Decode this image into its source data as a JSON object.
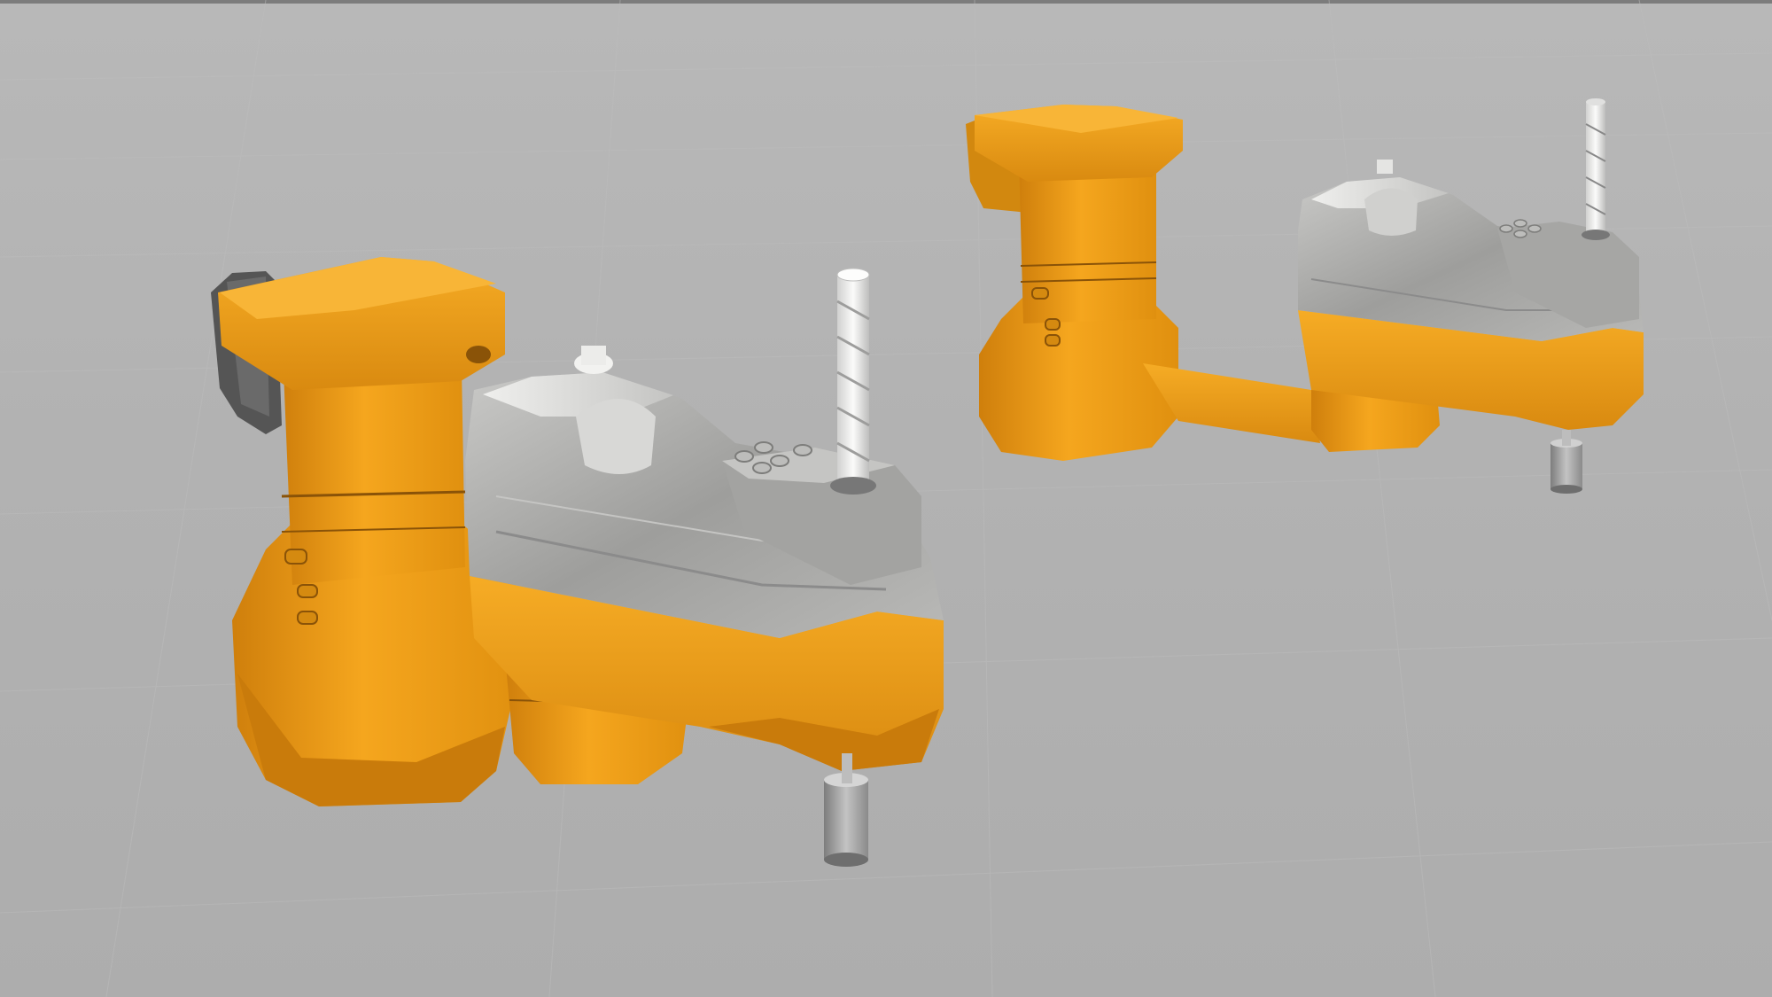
{
  "scene": {
    "background_color": "#b4b4b4",
    "grid_color": "#bcbcbc",
    "top_edge_color": "#7c7c7c",
    "robots": [
      {
        "name": "scara-robot-front",
        "colors": {
          "orange": "#f0a11c",
          "orange_dark": "#b86e0a",
          "silver": "#a9a9a9",
          "silver_light": "#e2e2e0",
          "motor": "#5a5a5a"
        }
      },
      {
        "name": "scara-robot-rear",
        "colors": {
          "orange": "#f0a11c",
          "orange_dark": "#b86e0a",
          "silver": "#a9a9a9",
          "silver_light": "#e2e2e0",
          "motor": "#5a5a5a"
        }
      }
    ]
  }
}
